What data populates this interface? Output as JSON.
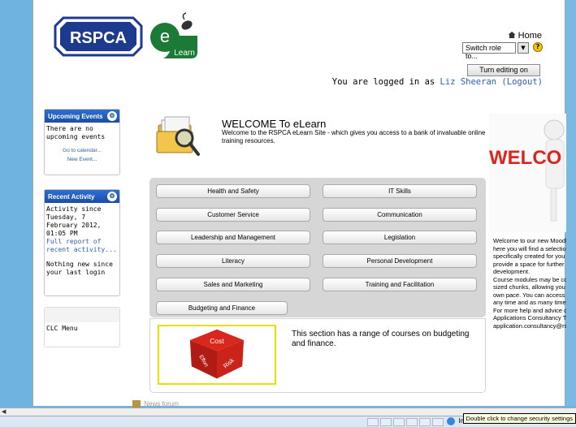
{
  "header": {
    "logo_text": "RSPCA",
    "elearn_letter": "e",
    "elearn_sub": "Learn",
    "home_label": "Home",
    "role_select": "Switch role to...",
    "edit_button": "Turn editing on",
    "login_prefix": "You are logged in as",
    "user_name": "Liz Sheeran",
    "logout_label": "(Logout)"
  },
  "blocks": {
    "upcoming": {
      "title": "Upcoming Events",
      "body": "There are no upcoming events",
      "calendar_link": "Go to calendar...",
      "new_event_link": "New Event..."
    },
    "recent": {
      "title": "Recent Activity",
      "since": "Activity since Tuesday, 7 February 2012, 01:05 PM",
      "full_report": "Full report of recent activity...",
      "nothing_new": "Nothing new since your last login"
    },
    "clc_menu": "CLC Menu"
  },
  "welcome": {
    "title": "WELCOME To eLearn",
    "text": "Welcome to the RSPCA eLearn Site - which gives you access to a bank of invaluable online training resources."
  },
  "categories": [
    "Health and Safety",
    "IT Skills",
    "Customer Service",
    "Communication",
    "Leadership and Management",
    "Legislation",
    "Literacy",
    "Personal Development",
    "Sales and Marketing",
    "Training and Facilitation",
    "Budgeting and Finance"
  ],
  "info": {
    "dice_words": [
      "Cost",
      "Effort",
      "Risk"
    ],
    "text": "This section has a range of courses on budgeting and finance."
  },
  "side": {
    "image_text": "WELCO",
    "lines": [
      "Welcome to our new Moodle e",
      "here you will find a selection o",
      "specifically created for you (RS",
      "provide a space for further lea",
      "development.",
      "Course modules may be comp",
      "sized chunks, allowing you to",
      "own pace. You can access an",
      "any time and as many times a",
      "For more help and advice cont",
      "Applications Consultancy Tea",
      "application.consultancy@rspc"
    ]
  },
  "news_forum": "News forum",
  "status": {
    "zone": "Internet",
    "tooltip": "Double click to change security settings"
  },
  "colors": {
    "block_header": "#1a4ea5",
    "link": "#2a5fb0",
    "page_bg": "#6fb3e0",
    "rspca_blue": "#1e3a8f",
    "elearn_green": "#1b7a35"
  }
}
